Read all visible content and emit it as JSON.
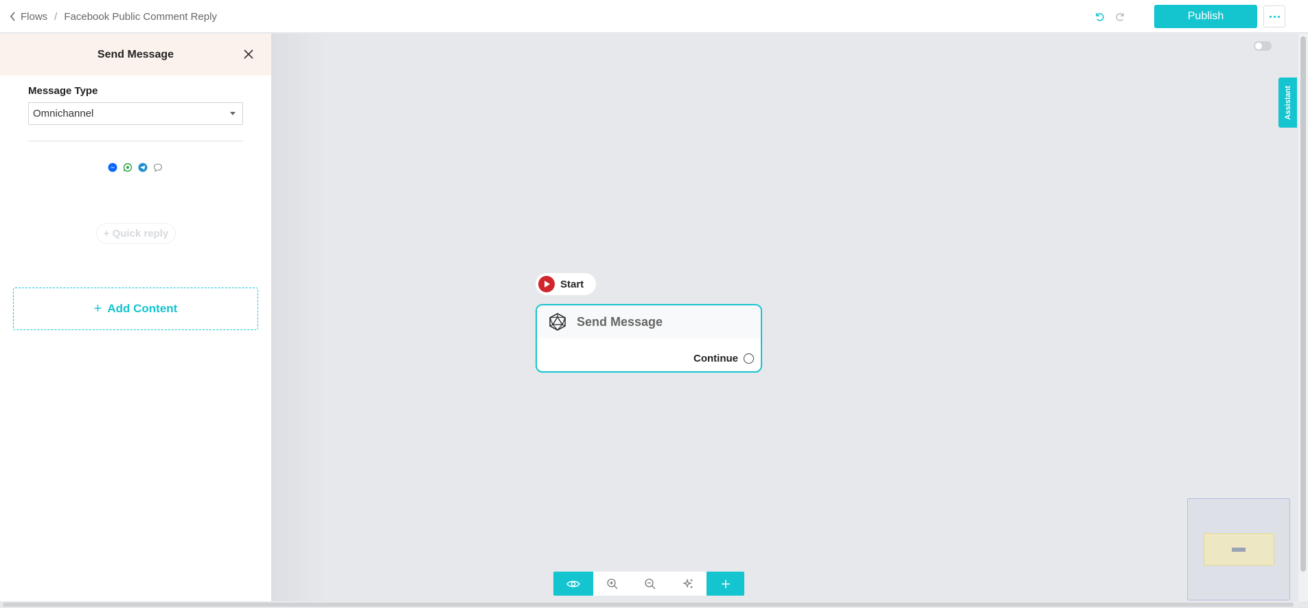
{
  "header": {
    "back_label": "Flows",
    "separator": "/",
    "flow_name": "Facebook Public Comment Reply",
    "publish_label": "Publish"
  },
  "panel": {
    "title": "Send Message",
    "message_type_label": "Message Type",
    "message_type_value": "Omnichannel",
    "channels": [
      "messenger-icon",
      "whatsapp-icon",
      "telegram-icon",
      "chat-icon"
    ],
    "quick_reply_label": "+ Quick reply",
    "add_content_label": "Add Content"
  },
  "canvas": {
    "start_label": "Start",
    "node_title": "Send Message",
    "node_output_label": "Continue"
  },
  "assistant_label": "Assistant",
  "colors": {
    "accent": "#14c4cf",
    "start_red": "#d0262c",
    "panel_header_bg": "#fbf2ed",
    "canvas_bg": "#e6e8ec"
  }
}
